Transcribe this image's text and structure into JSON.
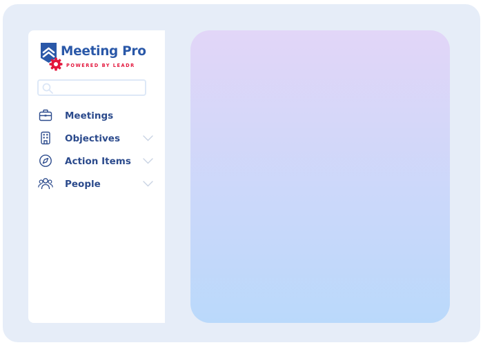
{
  "brand": {
    "name": "Meeting Pro",
    "tagline": "POWERED BY LEADR",
    "logo_icon": "shield-chevron-logo",
    "gear_icon": "gear-icon",
    "primary_color": "#2a58a8",
    "accent_color": "#e3163c"
  },
  "search": {
    "placeholder": "",
    "value": "",
    "icon": "search-icon"
  },
  "nav": {
    "items": [
      {
        "label": "Meetings",
        "icon": "briefcase-icon",
        "has_chevron": false
      },
      {
        "label": "Objectives",
        "icon": "building-icon",
        "has_chevron": true
      },
      {
        "label": "Action Items",
        "icon": "compass-icon",
        "has_chevron": true
      },
      {
        "label": "People",
        "icon": "people-icon",
        "has_chevron": true
      }
    ]
  }
}
